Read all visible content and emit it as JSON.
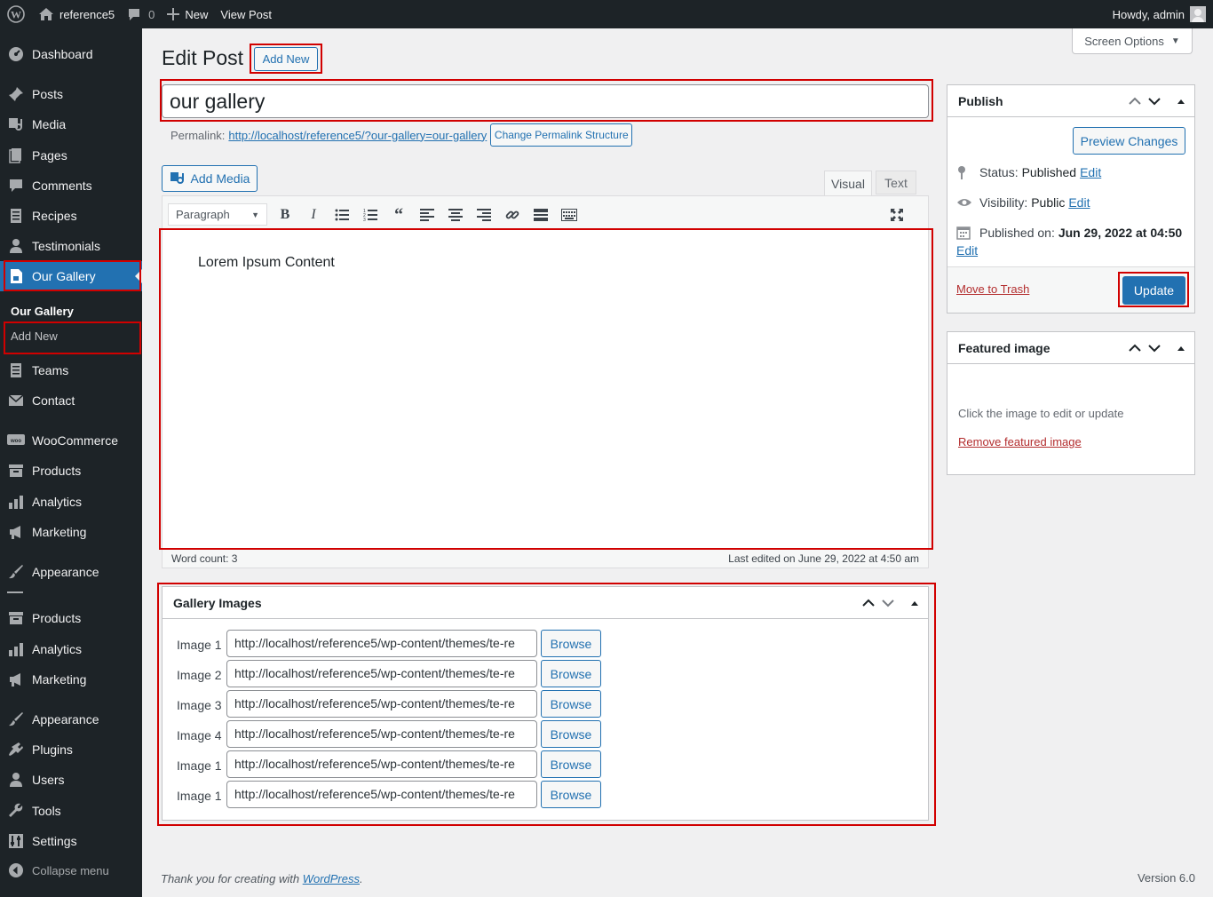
{
  "adminbar": {
    "site_name": "reference5",
    "comments_count": "0",
    "new_label": "New",
    "view_post_label": "View Post",
    "howdy": "Howdy, admin"
  },
  "sidebar": {
    "items": [
      {
        "label": "Dashboard",
        "icon": "dashboard-icon"
      },
      {
        "label": "Posts",
        "icon": "pin-icon"
      },
      {
        "label": "Media",
        "icon": "media-icon"
      },
      {
        "label": "Pages",
        "icon": "page-icon"
      },
      {
        "label": "Comments",
        "icon": "comment-icon"
      },
      {
        "label": "Recipes",
        "icon": "document-icon"
      },
      {
        "label": "Testimonials",
        "icon": "user-icon"
      },
      {
        "label": "Our Gallery",
        "icon": "gallery-icon"
      },
      {
        "label": "Teams",
        "icon": "document-icon"
      },
      {
        "label": "Contact",
        "icon": "mail-icon"
      },
      {
        "label": "WooCommerce",
        "icon": "woo-icon"
      },
      {
        "label": "Products",
        "icon": "archive-icon"
      },
      {
        "label": "Analytics",
        "icon": "chart-icon"
      },
      {
        "label": "Marketing",
        "icon": "megaphone-icon"
      },
      {
        "label": "Appearance",
        "icon": "brush-icon"
      },
      {
        "label": "Products",
        "icon": "archive-icon"
      },
      {
        "label": "Analytics",
        "icon": "chart-icon"
      },
      {
        "label": "Marketing",
        "icon": "megaphone-icon"
      },
      {
        "label": "Appearance",
        "icon": "brush-icon"
      },
      {
        "label": "Plugins",
        "icon": "plugin-icon"
      },
      {
        "label": "Users",
        "icon": "user-icon"
      },
      {
        "label": "Tools",
        "icon": "wrench-icon"
      },
      {
        "label": "Settings",
        "icon": "settings-icon"
      }
    ],
    "submenu": [
      "Our Gallery",
      "Add New"
    ],
    "collapse_label": "Collapse menu"
  },
  "header": {
    "title": "Edit Post",
    "add_new": "Add New",
    "screen_options": "Screen Options"
  },
  "post": {
    "title": "our gallery",
    "permalink_label": "Permalink:",
    "permalink_url": "http://localhost/reference5/?our-gallery=our-gallery",
    "change_permalink": "Change Permalink Structure"
  },
  "editor": {
    "add_media": "Add Media",
    "tab_visual": "Visual",
    "tab_text": "Text",
    "format_select": "Paragraph",
    "content": "Lorem Ipsum Content",
    "word_count": "Word count: 3",
    "last_edited": "Last edited on June 29, 2022 at 4:50 am"
  },
  "publish": {
    "title": "Publish",
    "preview": "Preview Changes",
    "status_label": "Status:",
    "status_value": "Published",
    "visibility_label": "Visibility:",
    "visibility_value": "Public",
    "published_label": "Published on:",
    "published_value": "Jun 29, 2022 at 04:50",
    "edit": "Edit",
    "trash": "Move to Trash",
    "update": "Update"
  },
  "featured": {
    "title": "Featured image",
    "hint": "Click the image to edit or update",
    "remove": "Remove featured image"
  },
  "gallery": {
    "title": "Gallery Images",
    "browse": "Browse",
    "rows": [
      {
        "label": "Image 1",
        "value": "http://localhost/reference5/wp-content/themes/te-re"
      },
      {
        "label": "Image 2",
        "value": "http://localhost/reference5/wp-content/themes/te-re"
      },
      {
        "label": "Image 3",
        "value": "http://localhost/reference5/wp-content/themes/te-re"
      },
      {
        "label": "Image 4",
        "value": "http://localhost/reference5/wp-content/themes/te-re"
      },
      {
        "label": "Image 1",
        "value": "http://localhost/reference5/wp-content/themes/te-re"
      },
      {
        "label": "Image 1",
        "value": "http://localhost/reference5/wp-content/themes/te-re"
      }
    ]
  },
  "footer": {
    "thanks_prefix": "Thank you for creating with ",
    "wordpress": "WordPress",
    "thanks_suffix": ".",
    "version": "Version 6.0"
  }
}
